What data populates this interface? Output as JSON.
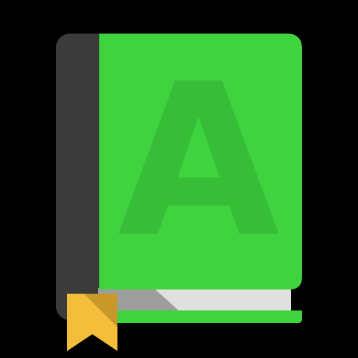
{
  "app_icon": {
    "icon_name": "dictionary-book-icon",
    "cover_letter": "A",
    "colors": {
      "background": "#000000",
      "spine": "#3b3b3b",
      "cover": "#3fd43f",
      "cover_highlight": "#4ddd4d",
      "letter": "#37bd37",
      "pages_shadow": "#9e9e9e",
      "pages": "#e0e0e0",
      "bookmark": "#f4bd3a",
      "bookmark_shadow": "#c9982a"
    }
  }
}
